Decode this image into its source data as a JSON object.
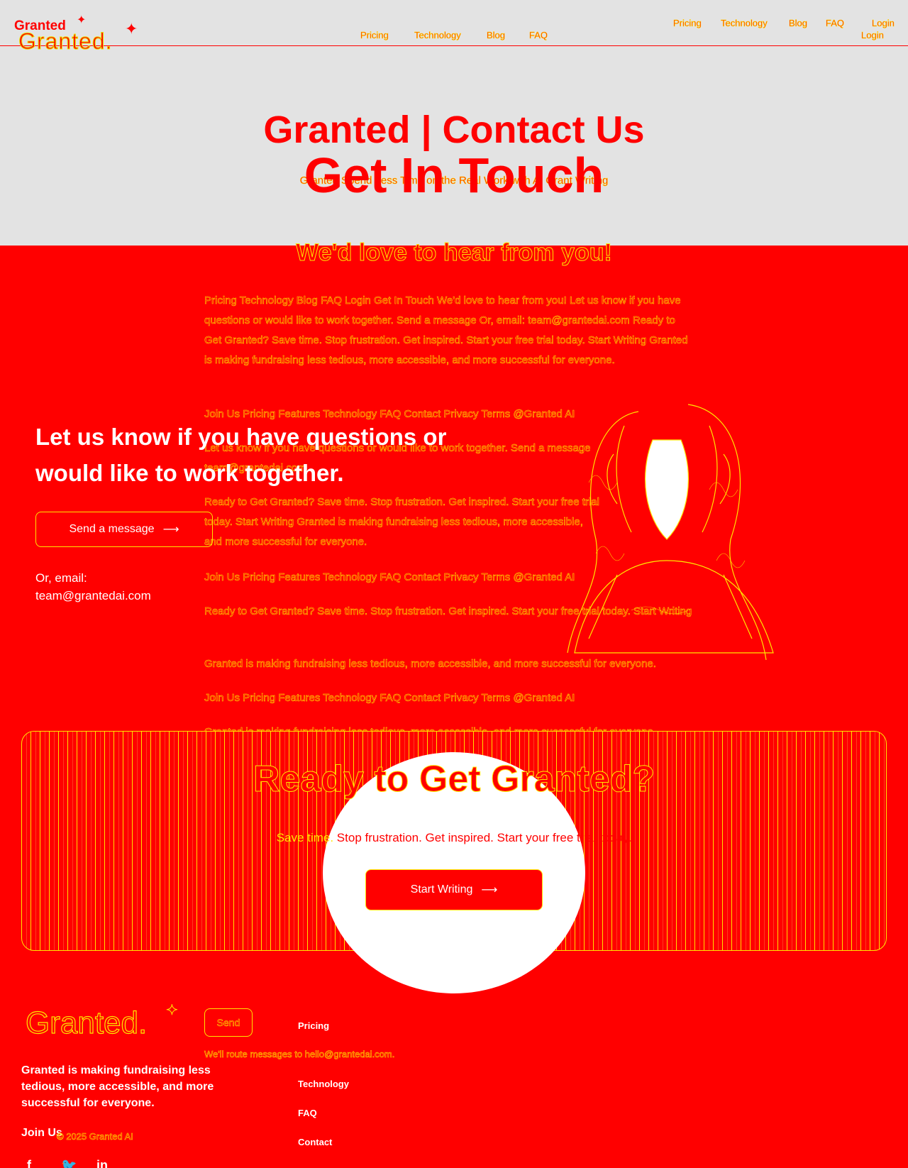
{
  "brand": {
    "logo_small": "Granted",
    "logo_large": "Granted."
  },
  "nav_center": [
    "Pricing",
    "Technology",
    "Blog",
    "FAQ"
  ],
  "nav_right": [
    "Pricing",
    "Technology",
    "Blog",
    "FAQ"
  ],
  "login": [
    "Login",
    "Login"
  ],
  "hero": {
    "title": "Granted | Contact Us",
    "overlay_title": "Get In Touch",
    "subtitle": "Granted Spend Less Time on the Real Work with AI Grant Writing",
    "love": "We'd love to hear from you!"
  },
  "body_blocks": [
    "Pricing Technology Blog FAQ Login Get In Touch We'd love to hear from you! Let us know if you have questions or would like to work together. Send a message Or, email: team@grantedai.com Ready to Get Granted? Save time. Stop frustration. Get inspired. Start your free trial today. Start Writing Granted is making fundraising less tedious, more accessible, and more successful for everyone.",
    "Join Us Pricing Features Technology FAQ Contact Privacy Terms @Granted AI",
    "Let us know if you have questions or would like to work together. Send a message team@grantedai.com",
    "Ready to Get Granted? Save time. Stop frustration. Get inspired. Start your free trial today. Start Writing Granted is making fundraising less tedious, more accessible, and more successful for everyone.",
    "Join Us Pricing Features Technology FAQ Contact Privacy Terms @Granted AI",
    "Ready to Get Granted? Save time. Stop frustration. Get inspired. Start your free trial today. Start Writing",
    "Granted is making fundraising less tedious, more accessible, and more successful for everyone.",
    "Join Us Pricing Features Technology FAQ Contact Privacy Terms @Granted AI",
    "Granted is making fundraising less tedious, more accessible, and more successful for everyone."
  ],
  "contact": {
    "heading": "Let us know if you have questions or would like to work together.",
    "send_button": "Send a message",
    "email_label": "Or, email:",
    "email": "team@grantedai.com"
  },
  "cta": {
    "title": "Ready to Get Granted?",
    "subtitle_pre": "Save time.",
    "subtitle": "Stop frustration. Get inspired. Start your free trial today.",
    "button": "Start Writing"
  },
  "footer": {
    "tagline": "Granted is making fundraising less tedious, more accessible, and more successful for everyone.",
    "join": "Join Us",
    "copyright": "© 2025 Granted AI",
    "send": "Send",
    "reply": "We'll route messages to hello@grantedai.com.",
    "links": [
      "Pricing",
      "Technology",
      "FAQ",
      "Contact"
    ]
  },
  "colors": {
    "bg": "#ff0000",
    "header_bg": "#e3e3e3",
    "accent": "#ffe600"
  },
  "icons": [
    "arrow-right-icon",
    "sparkle-icon",
    "facebook-icon",
    "twitter-icon",
    "linkedin-icon"
  ]
}
